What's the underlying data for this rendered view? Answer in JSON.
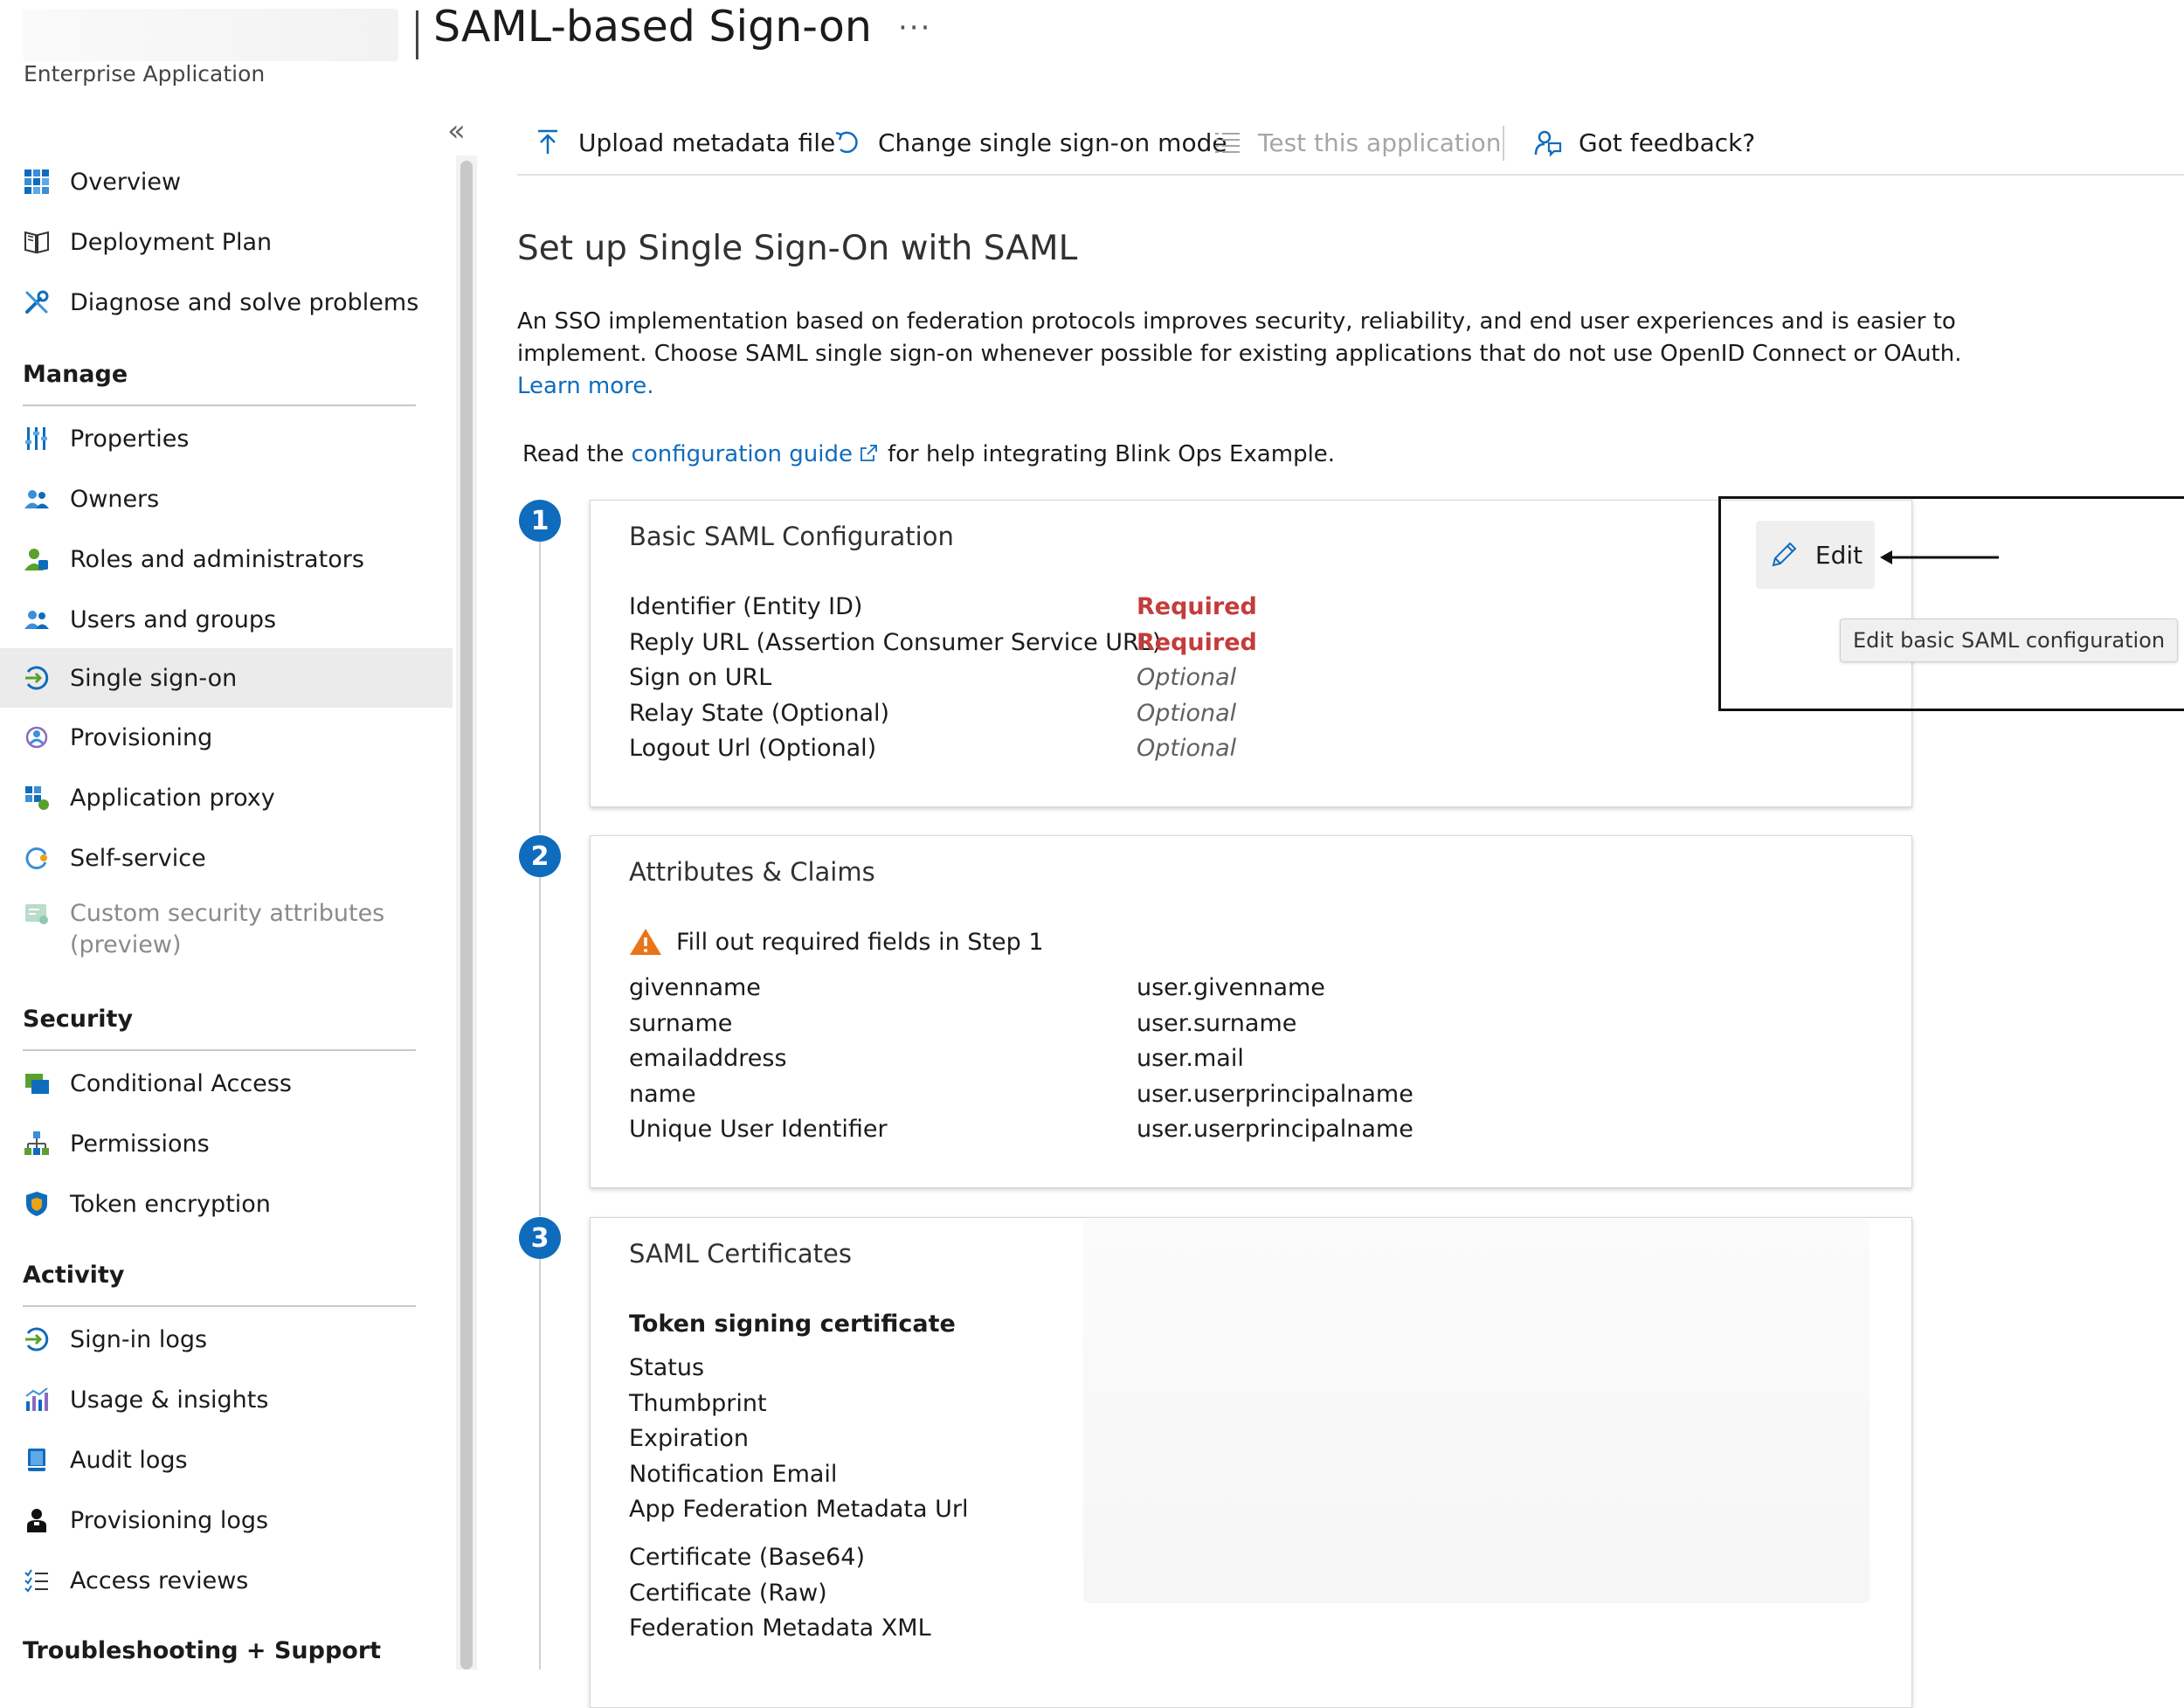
{
  "header": {
    "title": "SAML-based Sign-on",
    "more": "···",
    "subtitle": "Enterprise Application"
  },
  "sidebar": {
    "collapse": "«",
    "items_top": [
      {
        "label": "Overview",
        "icon": "overview-icon"
      },
      {
        "label": "Deployment Plan",
        "icon": "book-icon"
      },
      {
        "label": "Diagnose and solve problems",
        "icon": "wrench-icon"
      }
    ],
    "sections": {
      "manage": "Manage",
      "security": "Security",
      "activity": "Activity",
      "troubleshooting": "Troubleshooting + Support"
    },
    "manage_items": [
      {
        "label": "Properties",
        "icon": "properties-icon"
      },
      {
        "label": "Owners",
        "icon": "owners-icon"
      },
      {
        "label": "Roles and administrators",
        "icon": "roles-icon"
      },
      {
        "label": "Users and groups",
        "icon": "users-groups-icon"
      },
      {
        "label": "Single sign-on",
        "icon": "sso-icon",
        "active": true
      },
      {
        "label": "Provisioning",
        "icon": "provisioning-icon"
      },
      {
        "label": "Application proxy",
        "icon": "app-proxy-icon"
      },
      {
        "label": "Self-service",
        "icon": "self-service-icon"
      },
      {
        "label": "Custom security attributes",
        "label2": "(preview)",
        "icon": "custom-attributes-icon",
        "disabled": true
      }
    ],
    "security_items": [
      {
        "label": "Conditional Access",
        "icon": "conditional-access-icon"
      },
      {
        "label": "Permissions",
        "icon": "permissions-icon"
      },
      {
        "label": "Token encryption",
        "icon": "shield-icon"
      }
    ],
    "activity_items": [
      {
        "label": "Sign-in logs",
        "icon": "signin-logs-icon"
      },
      {
        "label": "Usage & insights",
        "icon": "chart-icon"
      },
      {
        "label": "Audit logs",
        "icon": "audit-logs-icon"
      },
      {
        "label": "Provisioning logs",
        "icon": "person-icon"
      },
      {
        "label": "Access reviews",
        "icon": "checklist-icon"
      }
    ]
  },
  "toolbar": {
    "upload": "Upload metadata file",
    "change_mode": "Change single sign-on mode",
    "test": "Test this application",
    "feedback": "Got feedback?"
  },
  "main": {
    "heading": "Set up Single Sign-On with SAML",
    "description": "An SSO implementation based on federation protocols improves security, reliability, and end user experiences and is easier to implement. Choose SAML single sign-on whenever possible for existing applications that do not use OpenID Connect or OAuth.",
    "learn_more": "Learn more.",
    "read_prefix": "Read the",
    "config_guide": "configuration guide",
    "read_suffix": "for help integrating Blink Ops Example."
  },
  "step1": {
    "number": "1",
    "title": "Basic SAML Configuration",
    "rows": [
      {
        "key": "Identifier (Entity ID)",
        "value": "Required",
        "status": "required"
      },
      {
        "key": "Reply URL (Assertion Consumer Service URL)",
        "value": "Required",
        "status": "required"
      },
      {
        "key": "Sign on URL",
        "value": "Optional",
        "status": "optional"
      },
      {
        "key": "Relay State (Optional)",
        "value": "Optional",
        "status": "optional"
      },
      {
        "key": "Logout Url (Optional)",
        "value": "Optional",
        "status": "optional"
      }
    ],
    "edit_label": "Edit",
    "tooltip": "Edit basic SAML configuration"
  },
  "step2": {
    "number": "2",
    "title": "Attributes & Claims",
    "warning": "Fill out required fields in Step 1",
    "rows": [
      {
        "key": "givenname",
        "value": "user.givenname"
      },
      {
        "key": "surname",
        "value": "user.surname"
      },
      {
        "key": "emailaddress",
        "value": "user.mail"
      },
      {
        "key": "name",
        "value": "user.userprincipalname"
      },
      {
        "key": "Unique User Identifier",
        "value": "user.userprincipalname"
      }
    ]
  },
  "step3": {
    "number": "3",
    "title": "SAML Certificates",
    "subheading": "Token signing certificate",
    "rows": [
      "Status",
      "Thumbprint",
      "Expiration",
      "Notification Email",
      "App Federation Metadata Url"
    ],
    "rows2": [
      "Certificate (Base64)",
      "Certificate (Raw)",
      "Federation Metadata XML"
    ]
  },
  "colors": {
    "accent": "#0f6cbd",
    "required": "#c43c3c",
    "warning": "#e8751a"
  }
}
